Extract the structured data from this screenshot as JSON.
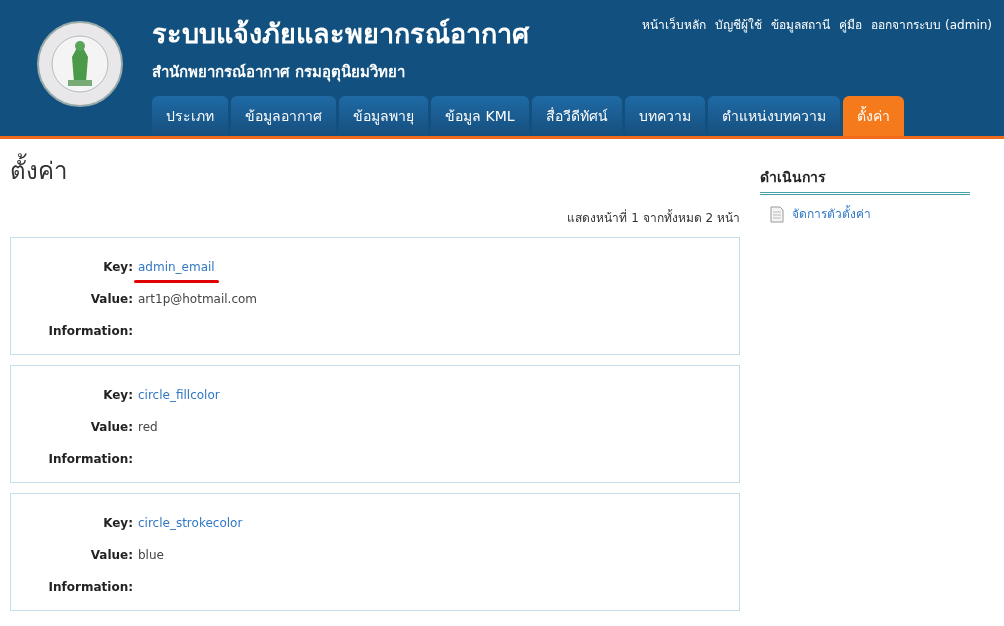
{
  "header": {
    "title": "ระบบแจ้งภัยและพยากรณ์อากาศ",
    "subtitle": "สำนักพยากรณ์อากาศ กรมอุตุนิยมวิทยา",
    "top_links": [
      "หน้าเว็บหลัก",
      "บัญชีผู้ใช้",
      "ข้อมูลสถานี",
      "คู่มือ",
      "ออกจากระบบ (admin)"
    ],
    "tabs": [
      {
        "label": "ประเภท",
        "selected": false
      },
      {
        "label": "ข้อมูลอากาศ",
        "selected": false
      },
      {
        "label": "ข้อมูลพายุ",
        "selected": false
      },
      {
        "label": "ข้อมูล KML",
        "selected": false
      },
      {
        "label": "สื่อวีดีทัศน์",
        "selected": false
      },
      {
        "label": "บทความ",
        "selected": false
      },
      {
        "label": "ตำแหน่งบทความ",
        "selected": false
      },
      {
        "label": "ตั้งค่า",
        "selected": true
      }
    ]
  },
  "page_title": "ตั้งค่า",
  "pager": "แสดงหน้าที่ 1 จากทั้งหมด 2 หน้า",
  "records": [
    {
      "key_label": "Key:",
      "key": "admin_email",
      "value_label": "Value:",
      "value": "art1p@hotmail.com",
      "info_label": "Information:",
      "underlined": true
    },
    {
      "key_label": "Key:",
      "key": "circle_fillcolor",
      "value_label": "Value:",
      "value": "red",
      "info_label": "Information:",
      "underlined": false
    },
    {
      "key_label": "Key:",
      "key": "circle_strokecolor",
      "value_label": "Value:",
      "value": "blue",
      "info_label": "Information:",
      "underlined": false
    }
  ],
  "sidebar": {
    "title": "ดำเนินการ",
    "items": [
      "จัดการตัวตั้งค่า"
    ]
  }
}
